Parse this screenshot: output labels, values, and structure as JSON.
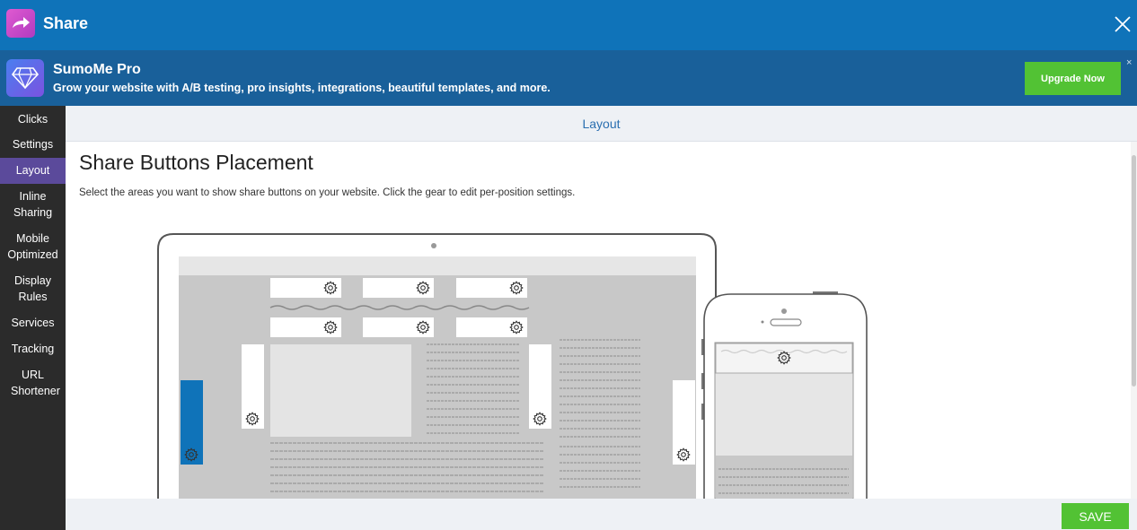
{
  "app": {
    "title": "Share"
  },
  "promo": {
    "title": "SumoMe Pro",
    "subtitle": "Grow your website with A/B testing, pro insights, integrations, beautiful templates, and more.",
    "upgrade_label": "Upgrade Now",
    "close_label": "×"
  },
  "sidebar": {
    "items": [
      {
        "label": "Clicks",
        "active": false
      },
      {
        "label": "Settings",
        "active": false
      },
      {
        "label": "Layout",
        "active": true
      },
      {
        "label": "Inline Sharing",
        "active": false
      },
      {
        "label": "Mobile Optimized",
        "active": false
      },
      {
        "label": "Display Rules",
        "active": false
      },
      {
        "label": "Services",
        "active": false
      },
      {
        "label": "Tracking",
        "active": false
      },
      {
        "label": "URL Shortener",
        "active": false
      }
    ]
  },
  "subheader": {
    "title": "Layout"
  },
  "main": {
    "title": "Share Buttons Placement",
    "description": "Select the areas you want to show share buttons on your website. Click the gear to edit per-position settings."
  },
  "footer": {
    "save_label": "SAVE"
  },
  "colors": {
    "topbar": "#0f73b9",
    "promo": "#19609a",
    "accent_green": "#52c234",
    "sidebar_active": "#5b4a9b",
    "selected_position": "#0f73b9"
  }
}
